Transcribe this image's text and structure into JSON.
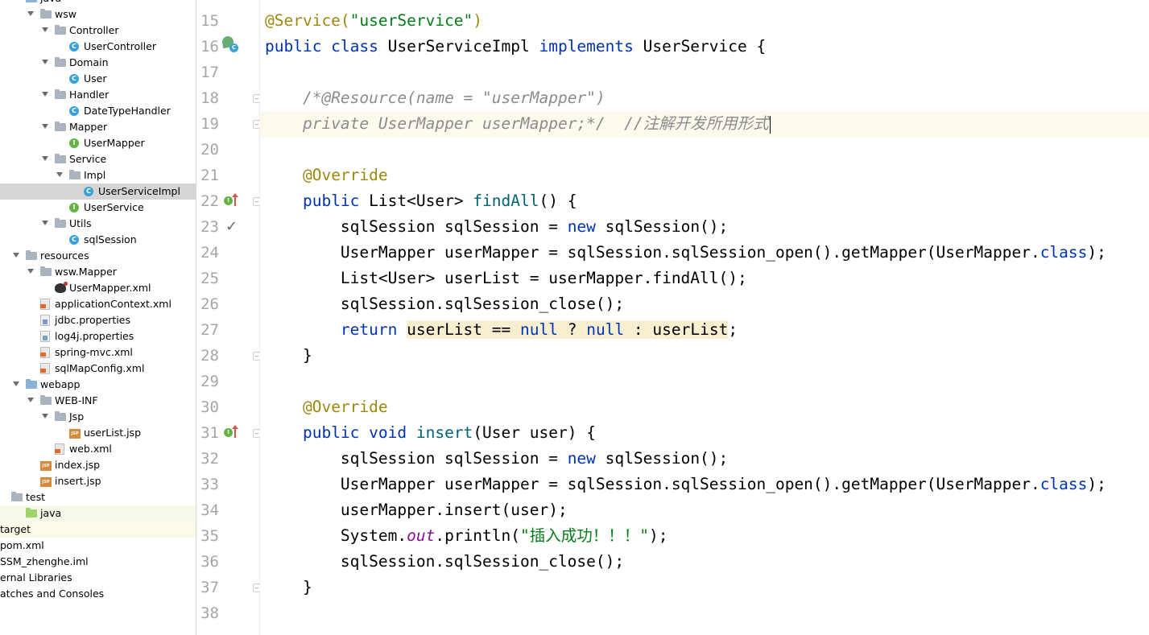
{
  "sidebar": {
    "items": [
      {
        "label": "java",
        "depth": 1,
        "icon": "folder-blue",
        "arrow": true
      },
      {
        "label": "wsw",
        "depth": 2,
        "icon": "folder",
        "arrow": true
      },
      {
        "label": "Controller",
        "depth": 3,
        "icon": "folder",
        "arrow": true
      },
      {
        "label": "UserController",
        "depth": 4,
        "icon": "class"
      },
      {
        "label": "Domain",
        "depth": 3,
        "icon": "folder",
        "arrow": true
      },
      {
        "label": "User",
        "depth": 4,
        "icon": "class"
      },
      {
        "label": "Handler",
        "depth": 3,
        "icon": "folder",
        "arrow": true
      },
      {
        "label": "DateTypeHandler",
        "depth": 4,
        "icon": "class"
      },
      {
        "label": "Mapper",
        "depth": 3,
        "icon": "folder",
        "arrow": true
      },
      {
        "label": "UserMapper",
        "depth": 4,
        "icon": "interface"
      },
      {
        "label": "Service",
        "depth": 3,
        "icon": "folder",
        "arrow": true
      },
      {
        "label": "Impl",
        "depth": 4,
        "icon": "folder",
        "arrow": true
      },
      {
        "label": "UserServiceImpl",
        "depth": 5,
        "icon": "class",
        "selected": true
      },
      {
        "label": "UserService",
        "depth": 4,
        "icon": "interface"
      },
      {
        "label": "Utils",
        "depth": 3,
        "icon": "folder",
        "arrow": true
      },
      {
        "label": "sqlSession",
        "depth": 4,
        "icon": "class"
      },
      {
        "label": "resources",
        "depth": 1,
        "icon": "folder",
        "arrow": true
      },
      {
        "label": "wsw.Mapper",
        "depth": 2,
        "icon": "folder",
        "arrow": true
      },
      {
        "label": "UserMapper.xml",
        "depth": 3,
        "icon": "mybatis"
      },
      {
        "label": "applicationContext.xml",
        "depth": 2,
        "icon": "xml"
      },
      {
        "label": "jdbc.properties",
        "depth": 2,
        "icon": "properties"
      },
      {
        "label": "log4j.properties",
        "depth": 2,
        "icon": "properties"
      },
      {
        "label": "spring-mvc.xml",
        "depth": 2,
        "icon": "xml"
      },
      {
        "label": "sqlMapConfig.xml",
        "depth": 2,
        "icon": "xml"
      },
      {
        "label": "webapp",
        "depth": 1,
        "icon": "folder-blue",
        "arrow": true
      },
      {
        "label": "WEB-INF",
        "depth": 2,
        "icon": "folder",
        "arrow": true
      },
      {
        "label": "Jsp",
        "depth": 3,
        "icon": "folder",
        "arrow": true
      },
      {
        "label": "userList.jsp",
        "depth": 4,
        "icon": "jsp"
      },
      {
        "label": "web.xml",
        "depth": 3,
        "icon": "xml"
      },
      {
        "label": "index.jsp",
        "depth": 2,
        "icon": "jsp"
      },
      {
        "label": "insert.jsp",
        "depth": 2,
        "icon": "jsp"
      },
      {
        "label": "test",
        "depth": 0,
        "icon": "folder"
      },
      {
        "label": "java",
        "depth": 1,
        "icon": "folder-green",
        "highlight": "green"
      },
      {
        "label": "target",
        "depth": -1,
        "icon": "none",
        "highlight": "yellow"
      },
      {
        "label": "pom.xml",
        "depth": -1,
        "icon": "none"
      },
      {
        "label": "SSM_zhenghe.iml",
        "depth": -1,
        "icon": "none"
      },
      {
        "label": "ernal Libraries",
        "depth": -1,
        "icon": "none"
      },
      {
        "label": "atches and Consoles",
        "depth": -1,
        "icon": "none"
      }
    ]
  },
  "editor": {
    "first_line_number": 15,
    "current_line": 19,
    "lines": [
      {
        "n": "15",
        "tokens": [
          [
            "ann",
            "@Service("
          ],
          [
            "str",
            "\"userService\""
          ],
          [
            "ann",
            ")"
          ]
        ]
      },
      {
        "n": "16",
        "gutter": "bean",
        "tokens": [
          [
            "kw",
            "public class "
          ],
          [
            "",
            "UserServiceImpl "
          ],
          [
            "kw",
            "implements "
          ],
          [
            "",
            "UserService {"
          ]
        ]
      },
      {
        "n": "17",
        "tokens": []
      },
      {
        "n": "18",
        "fold": true,
        "tokens": [
          [
            "",
            "    "
          ],
          [
            "cmt",
            "/*@Resource(name = \"userMapper\")"
          ]
        ]
      },
      {
        "n": "19",
        "fold": true,
        "caret": true,
        "tokens": [
          [
            "",
            "    "
          ],
          [
            "cmt",
            "private UserMapper userMapper;*/  //注解开发所用形式"
          ]
        ]
      },
      {
        "n": "20",
        "tokens": []
      },
      {
        "n": "21",
        "tokens": [
          [
            "",
            "    "
          ],
          [
            "ann",
            "@Override"
          ]
        ]
      },
      {
        "n": "22",
        "gutter": "impl",
        "fold": true,
        "tokens": [
          [
            "",
            "    "
          ],
          [
            "kw",
            "public "
          ],
          [
            "",
            "List<User> "
          ],
          [
            "mth",
            "findAll"
          ],
          [
            "",
            "() {"
          ]
        ]
      },
      {
        "n": "23",
        "gutter": "check",
        "tokens": [
          [
            "",
            "        sqlSession sqlSession = "
          ],
          [
            "kw",
            "new "
          ],
          [
            "",
            "sqlSession();"
          ]
        ]
      },
      {
        "n": "24",
        "tokens": [
          [
            "",
            "        UserMapper userMapper = sqlSession.sqlSession_open().getMapper(UserMapper."
          ],
          [
            "kw",
            "class"
          ],
          [
            "",
            ");"
          ]
        ]
      },
      {
        "n": "25",
        "tokens": [
          [
            "",
            "        List<User> userList = userMapper.findAll();"
          ]
        ]
      },
      {
        "n": "26",
        "tokens": [
          [
            "",
            "        sqlSession.sqlSession_close();"
          ]
        ]
      },
      {
        "n": "27",
        "tokens": [
          [
            "",
            "        "
          ],
          [
            "kw",
            "return "
          ],
          [
            "hl",
            "userList == "
          ],
          [
            "hlkw",
            "null"
          ],
          [
            "hl",
            " ? "
          ],
          [
            "hlkw",
            "null"
          ],
          [
            "hl",
            " : userList"
          ],
          [
            "",
            ";"
          ]
        ]
      },
      {
        "n": "28",
        "fold": true,
        "tokens": [
          [
            "",
            "    }"
          ]
        ]
      },
      {
        "n": "29",
        "tokens": []
      },
      {
        "n": "30",
        "tokens": [
          [
            "",
            "    "
          ],
          [
            "ann",
            "@Override"
          ]
        ]
      },
      {
        "n": "31",
        "gutter": "impl",
        "fold": true,
        "tokens": [
          [
            "",
            "    "
          ],
          [
            "kw",
            "public void "
          ],
          [
            "mth",
            "insert"
          ],
          [
            "",
            "(User user) {"
          ]
        ]
      },
      {
        "n": "32",
        "tokens": [
          [
            "",
            "        sqlSession sqlSession = "
          ],
          [
            "kw",
            "new "
          ],
          [
            "",
            "sqlSession();"
          ]
        ]
      },
      {
        "n": "33",
        "tokens": [
          [
            "",
            "        UserMapper userMapper = sqlSession.sqlSession_open().getMapper(UserMapper."
          ],
          [
            "kw",
            "class"
          ],
          [
            "",
            ");"
          ]
        ]
      },
      {
        "n": "34",
        "tokens": [
          [
            "",
            "        userMapper.insert(user);"
          ]
        ]
      },
      {
        "n": "35",
        "tokens": [
          [
            "",
            "        System."
          ],
          [
            "fld",
            "out"
          ],
          [
            "",
            ".println("
          ],
          [
            "str",
            "\"插入成功！！！\""
          ],
          [
            "",
            ");"
          ]
        ]
      },
      {
        "n": "36",
        "tokens": [
          [
            "",
            "        sqlSession.sqlSession_close();"
          ]
        ]
      },
      {
        "n": "37",
        "fold": true,
        "tokens": [
          [
            "",
            "    }"
          ]
        ]
      },
      {
        "n": "38",
        "tokens": []
      }
    ]
  },
  "colors": {
    "keyword": "#0033b3",
    "annotation": "#9e880d",
    "string": "#067d17",
    "comment": "#8c8c8c",
    "method": "#00627a",
    "static_field": "#871094",
    "selection": "#d5d5d5",
    "current_line": "#fcfaed",
    "usage_highlight": "#f8eed0"
  }
}
